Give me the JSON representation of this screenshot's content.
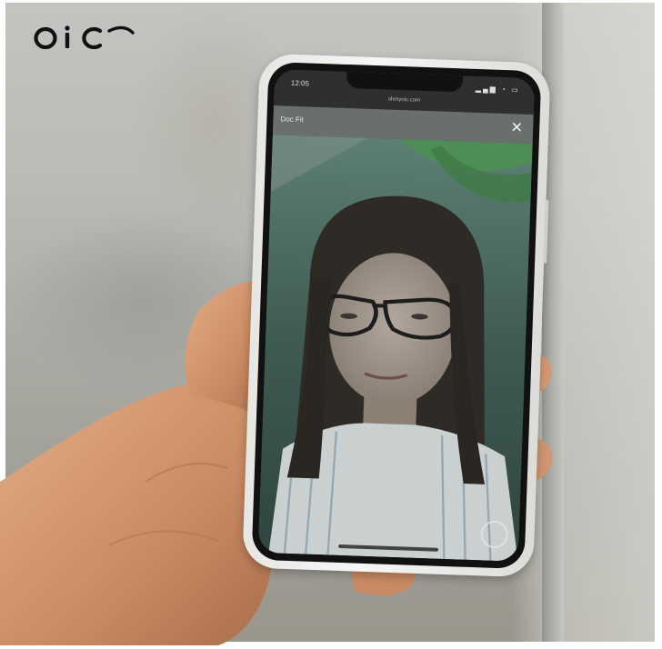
{
  "brand": {
    "logo_text": "OiC"
  },
  "phone": {
    "status_time": "12:05",
    "status_icons": "signal-wifi-battery",
    "url": "ohmyoic.com",
    "header_label": "Doc Fit",
    "close_icon": "close-icon",
    "capture_icon": "capture-icon"
  },
  "colors": {
    "background": "#ffffff",
    "logo": "#111111",
    "phone_shell": "#f0f0ee",
    "skin": "#d69a74"
  }
}
